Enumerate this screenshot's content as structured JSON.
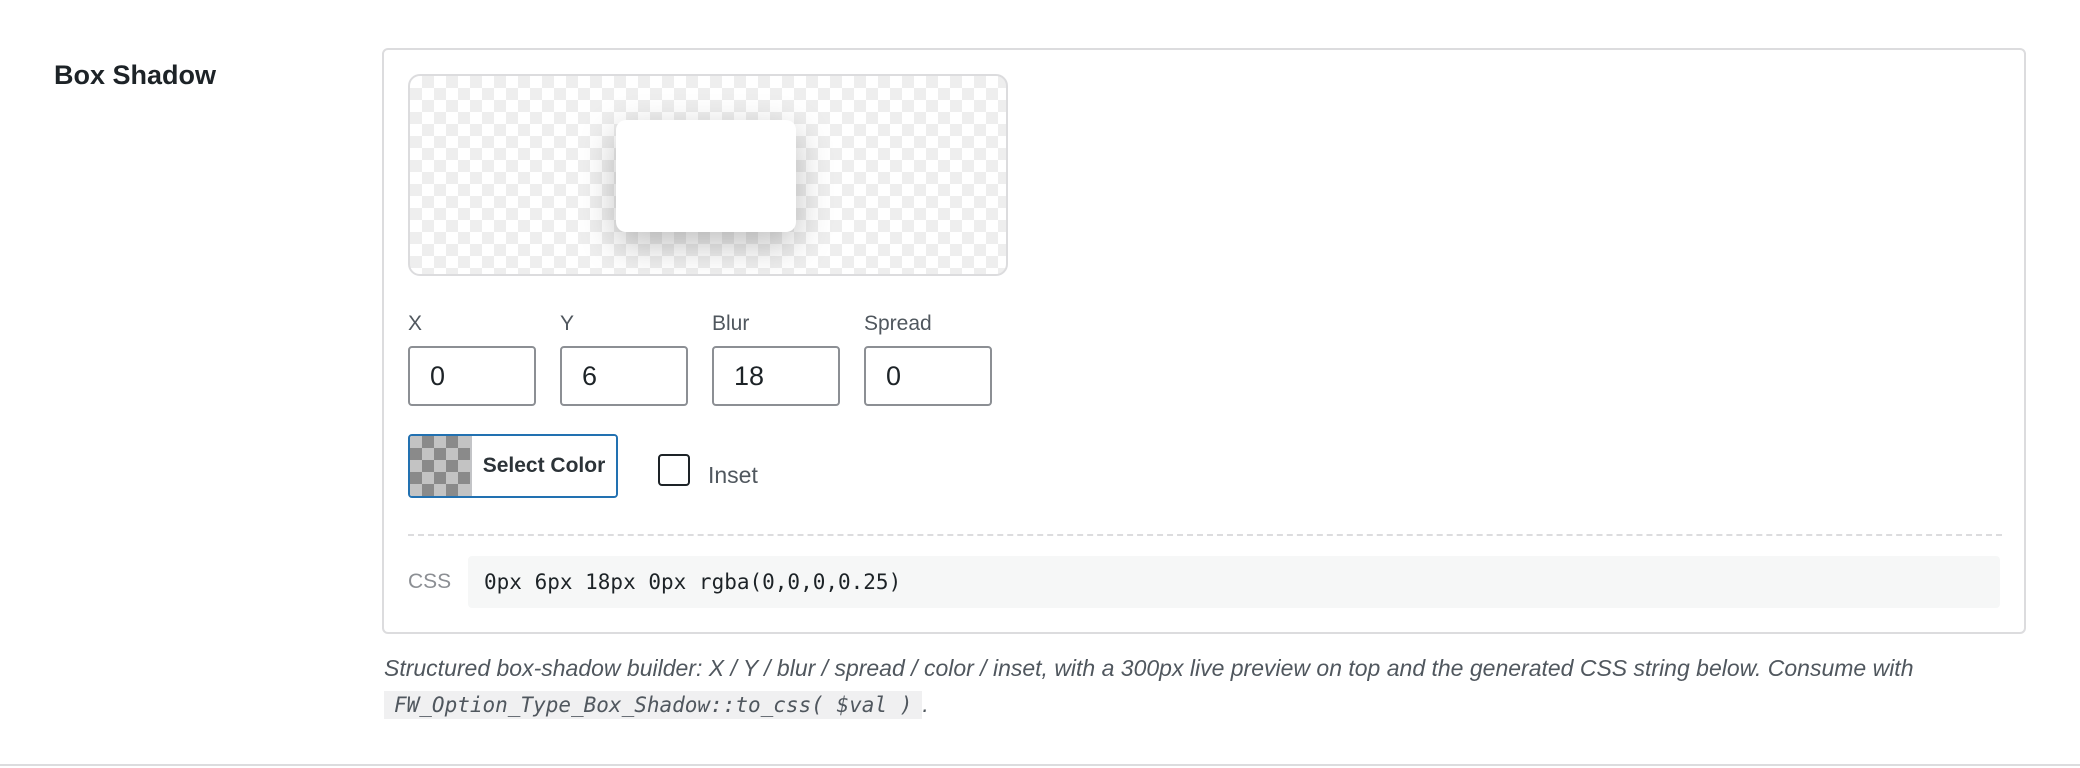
{
  "option": {
    "label": "Box Shadow"
  },
  "fields": {
    "x": {
      "label": "X",
      "value": "0"
    },
    "y": {
      "label": "Y",
      "value": "6"
    },
    "blur": {
      "label": "Blur",
      "value": "18"
    },
    "spread": {
      "label": "Spread",
      "value": "0"
    }
  },
  "color_picker": {
    "button_label": "Select Color"
  },
  "inset": {
    "label": "Inset",
    "checked": false
  },
  "css_output": {
    "label": "CSS",
    "value": "0px 6px 18px 0px rgba(0,0,0,0.25)"
  },
  "description": {
    "text_before": "Structured box-shadow builder: X / Y / blur / spread / color / inset, with a 300px live preview on top and the generated CSS string below. Consume with ",
    "code": "FW_Option_Type_Box_Shadow::to_css( $val )",
    "text_after": "."
  },
  "colors": {
    "accent": "#2271b1",
    "border": "#dcdcde",
    "text": "#1d2327",
    "muted": "#50575e"
  }
}
